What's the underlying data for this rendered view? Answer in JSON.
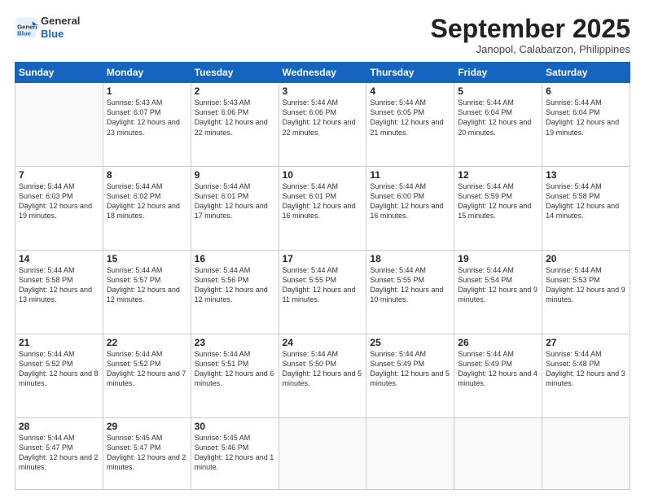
{
  "header": {
    "logo": {
      "general": "General",
      "blue": "Blue"
    },
    "title": "September 2025",
    "location": "Janopol, Calabarzon, Philippines"
  },
  "weekdays": [
    "Sunday",
    "Monday",
    "Tuesday",
    "Wednesday",
    "Thursday",
    "Friday",
    "Saturday"
  ],
  "weeks": [
    [
      {
        "day": null,
        "info": null
      },
      {
        "day": "1",
        "info": "Sunrise: 5:43 AM\nSunset: 6:07 PM\nDaylight: 12 hours\nand 23 minutes."
      },
      {
        "day": "2",
        "info": "Sunrise: 5:43 AM\nSunset: 6:06 PM\nDaylight: 12 hours\nand 22 minutes."
      },
      {
        "day": "3",
        "info": "Sunrise: 5:44 AM\nSunset: 6:06 PM\nDaylight: 12 hours\nand 22 minutes."
      },
      {
        "day": "4",
        "info": "Sunrise: 5:44 AM\nSunset: 6:05 PM\nDaylight: 12 hours\nand 21 minutes."
      },
      {
        "day": "5",
        "info": "Sunrise: 5:44 AM\nSunset: 6:04 PM\nDaylight: 12 hours\nand 20 minutes."
      },
      {
        "day": "6",
        "info": "Sunrise: 5:44 AM\nSunset: 6:04 PM\nDaylight: 12 hours\nand 19 minutes."
      }
    ],
    [
      {
        "day": "7",
        "info": "Sunrise: 5:44 AM\nSunset: 6:03 PM\nDaylight: 12 hours\nand 19 minutes."
      },
      {
        "day": "8",
        "info": "Sunrise: 5:44 AM\nSunset: 6:02 PM\nDaylight: 12 hours\nand 18 minutes."
      },
      {
        "day": "9",
        "info": "Sunrise: 5:44 AM\nSunset: 6:01 PM\nDaylight: 12 hours\nand 17 minutes."
      },
      {
        "day": "10",
        "info": "Sunrise: 5:44 AM\nSunset: 6:01 PM\nDaylight: 12 hours\nand 16 minutes."
      },
      {
        "day": "11",
        "info": "Sunrise: 5:44 AM\nSunset: 6:00 PM\nDaylight: 12 hours\nand 16 minutes."
      },
      {
        "day": "12",
        "info": "Sunrise: 5:44 AM\nSunset: 5:59 PM\nDaylight: 12 hours\nand 15 minutes."
      },
      {
        "day": "13",
        "info": "Sunrise: 5:44 AM\nSunset: 5:58 PM\nDaylight: 12 hours\nand 14 minutes."
      }
    ],
    [
      {
        "day": "14",
        "info": "Sunrise: 5:44 AM\nSunset: 5:58 PM\nDaylight: 12 hours\nand 13 minutes."
      },
      {
        "day": "15",
        "info": "Sunrise: 5:44 AM\nSunset: 5:57 PM\nDaylight: 12 hours\nand 12 minutes."
      },
      {
        "day": "16",
        "info": "Sunrise: 5:44 AM\nSunset: 5:56 PM\nDaylight: 12 hours\nand 12 minutes."
      },
      {
        "day": "17",
        "info": "Sunrise: 5:44 AM\nSunset: 5:55 PM\nDaylight: 12 hours\nand 11 minutes."
      },
      {
        "day": "18",
        "info": "Sunrise: 5:44 AM\nSunset: 5:55 PM\nDaylight: 12 hours\nand 10 minutes."
      },
      {
        "day": "19",
        "info": "Sunrise: 5:44 AM\nSunset: 5:54 PM\nDaylight: 12 hours\nand 9 minutes."
      },
      {
        "day": "20",
        "info": "Sunrise: 5:44 AM\nSunset: 5:53 PM\nDaylight: 12 hours\nand 9 minutes."
      }
    ],
    [
      {
        "day": "21",
        "info": "Sunrise: 5:44 AM\nSunset: 5:52 PM\nDaylight: 12 hours\nand 8 minutes."
      },
      {
        "day": "22",
        "info": "Sunrise: 5:44 AM\nSunset: 5:52 PM\nDaylight: 12 hours\nand 7 minutes."
      },
      {
        "day": "23",
        "info": "Sunrise: 5:44 AM\nSunset: 5:51 PM\nDaylight: 12 hours\nand 6 minutes."
      },
      {
        "day": "24",
        "info": "Sunrise: 5:44 AM\nSunset: 5:50 PM\nDaylight: 12 hours\nand 5 minutes."
      },
      {
        "day": "25",
        "info": "Sunrise: 5:44 AM\nSunset: 5:49 PM\nDaylight: 12 hours\nand 5 minutes."
      },
      {
        "day": "26",
        "info": "Sunrise: 5:44 AM\nSunset: 5:49 PM\nDaylight: 12 hours\nand 4 minutes."
      },
      {
        "day": "27",
        "info": "Sunrise: 5:44 AM\nSunset: 5:48 PM\nDaylight: 12 hours\nand 3 minutes."
      }
    ],
    [
      {
        "day": "28",
        "info": "Sunrise: 5:44 AM\nSunset: 5:47 PM\nDaylight: 12 hours\nand 2 minutes."
      },
      {
        "day": "29",
        "info": "Sunrise: 5:45 AM\nSunset: 5:47 PM\nDaylight: 12 hours\nand 2 minutes."
      },
      {
        "day": "30",
        "info": "Sunrise: 5:45 AM\nSunset: 5:46 PM\nDaylight: 12 hours\nand 1 minute."
      },
      {
        "day": null,
        "info": null
      },
      {
        "day": null,
        "info": null
      },
      {
        "day": null,
        "info": null
      },
      {
        "day": null,
        "info": null
      }
    ]
  ]
}
